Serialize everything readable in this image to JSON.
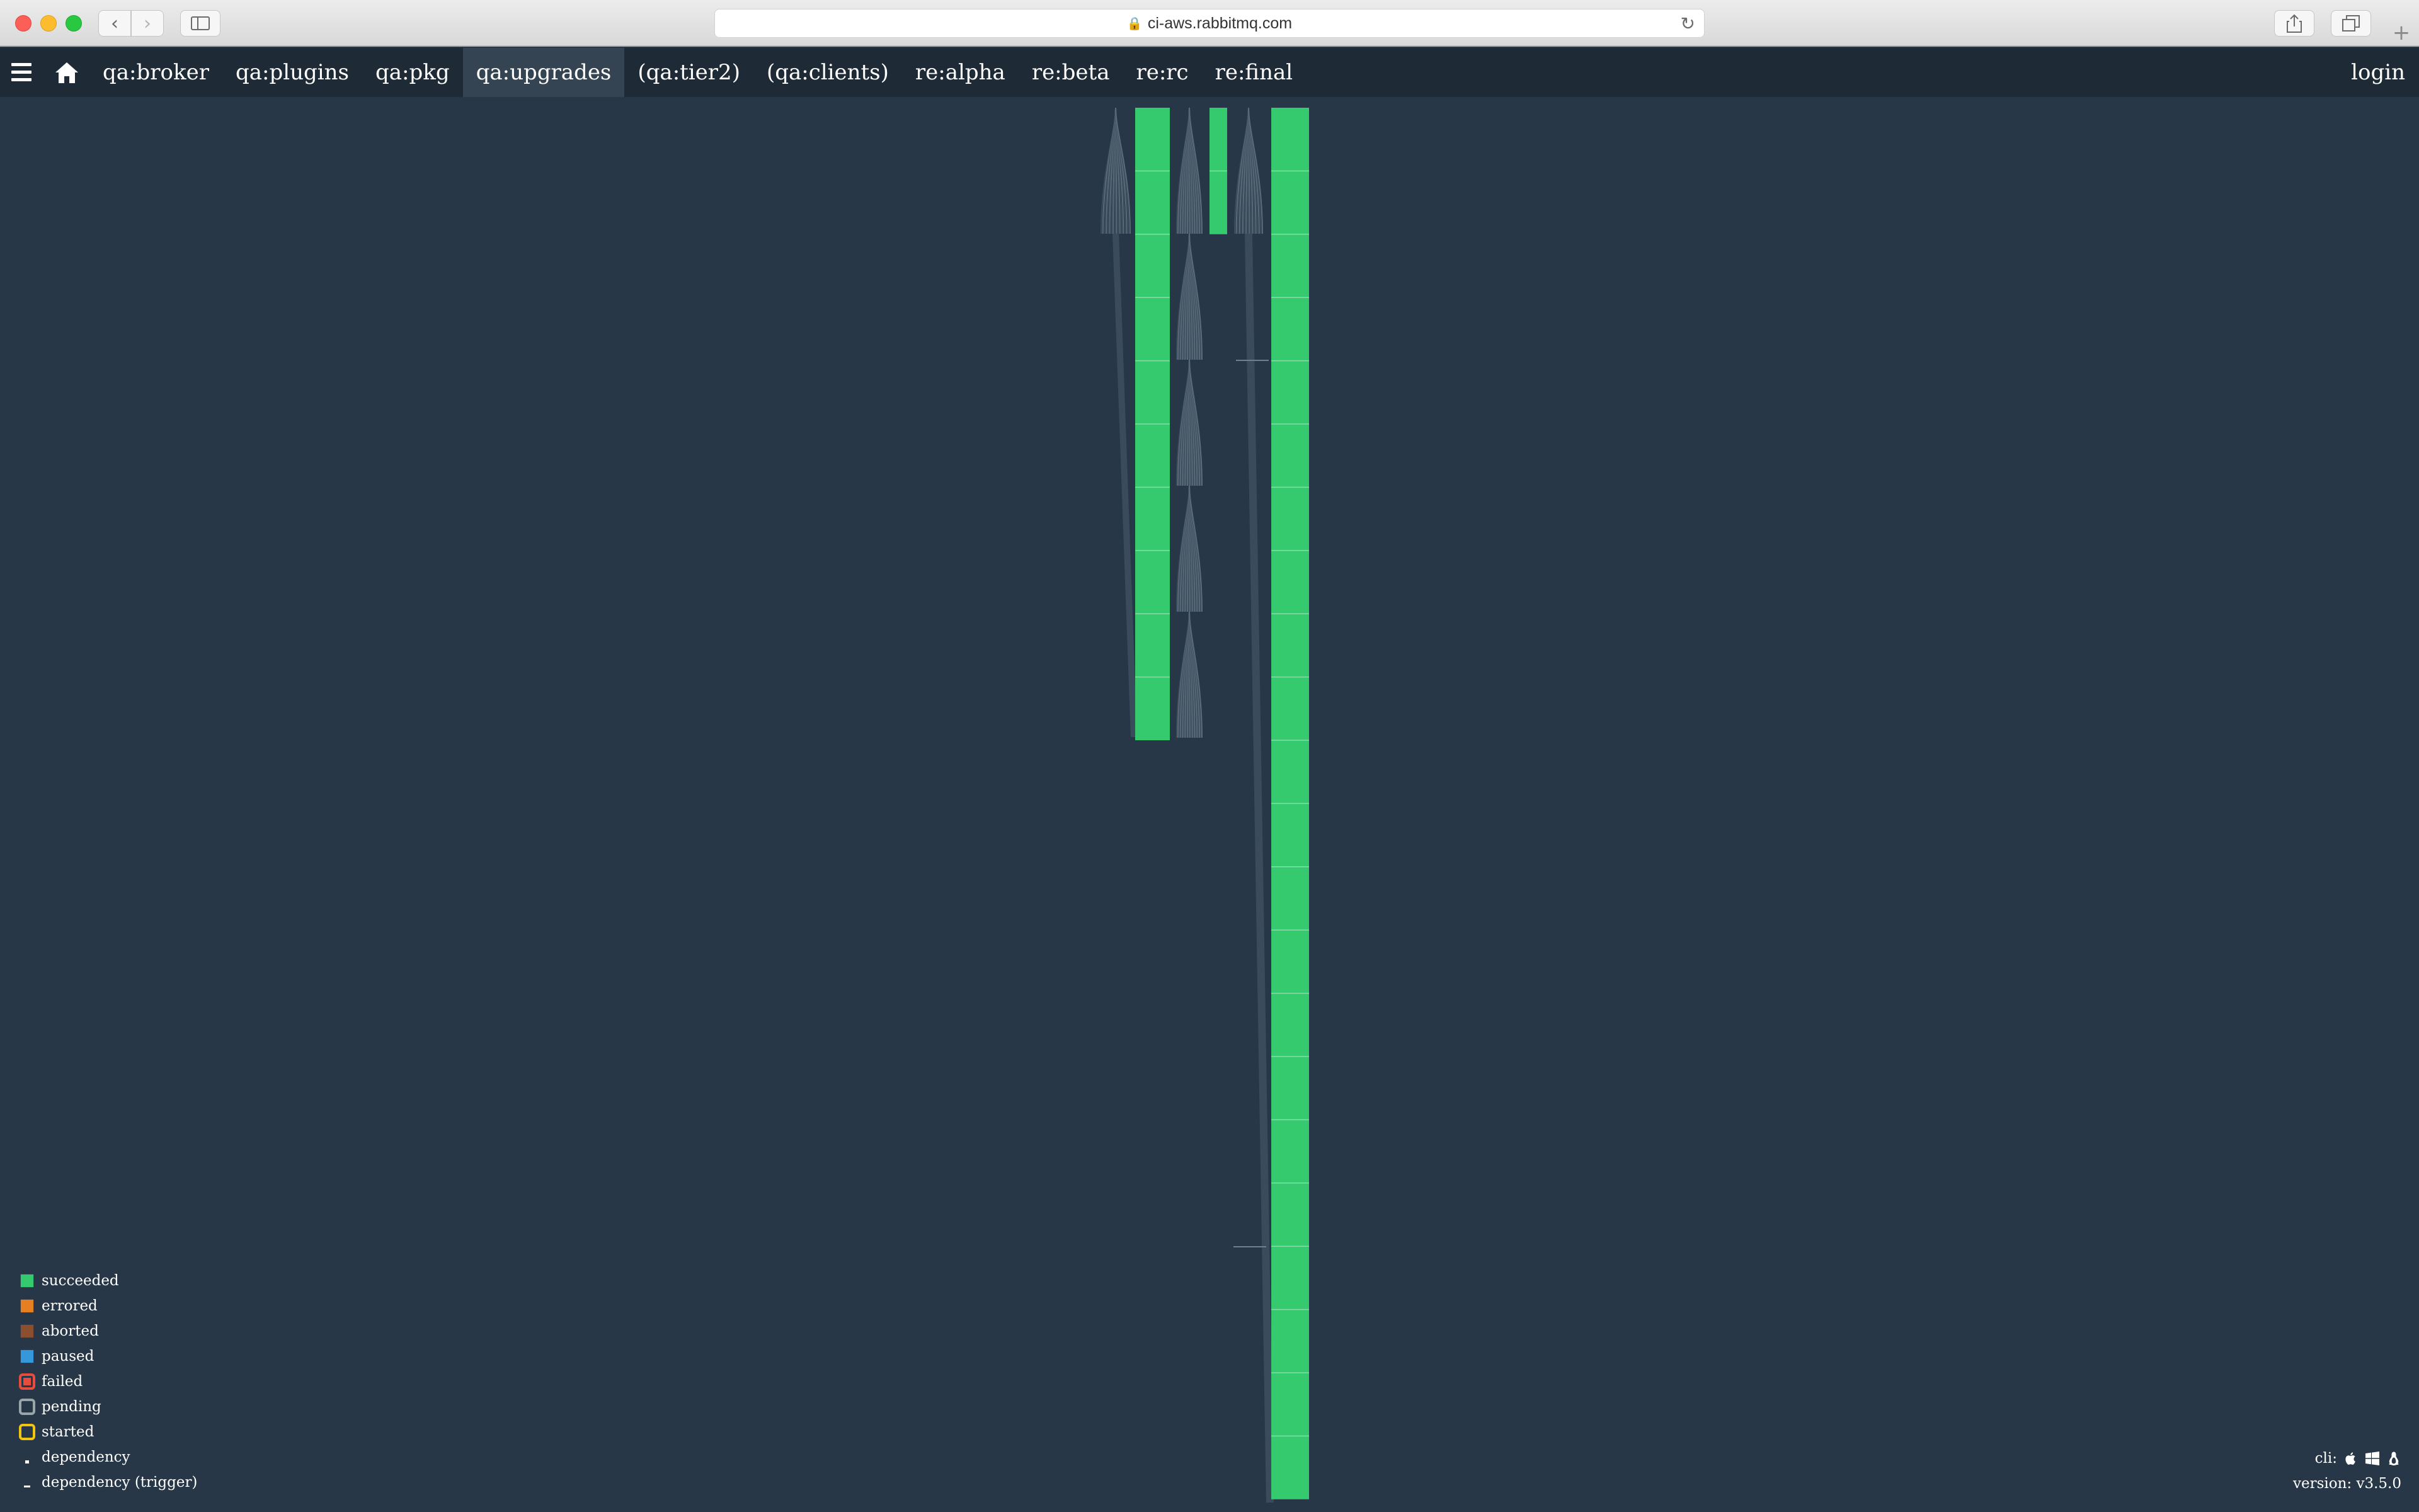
{
  "browser": {
    "url": "ci-aws.rabbitmq.com"
  },
  "topbar": {
    "groups": [
      {
        "label": "qa:broker",
        "active": false
      },
      {
        "label": "qa:plugins",
        "active": false
      },
      {
        "label": "qa:pkg",
        "active": false
      },
      {
        "label": "qa:upgrades",
        "active": true
      },
      {
        "label": "(qa:tier2)",
        "active": false
      },
      {
        "label": "(qa:clients)",
        "active": false
      },
      {
        "label": "re:alpha",
        "active": false
      },
      {
        "label": "re:beta",
        "active": false
      },
      {
        "label": "re:rc",
        "active": false
      },
      {
        "label": "re:final",
        "active": false
      }
    ],
    "login_label": "login"
  },
  "pipeline": {
    "colors": {
      "succeeded": "#36ca6f",
      "errored": "#e67e22",
      "aborted": "#8b4e2e",
      "paused": "#3498db",
      "failed": "#e74c3c",
      "pending": "#9aa4ab",
      "started": "#f1c40f",
      "edge": "#3a4c5b",
      "background": "#273747"
    },
    "columns": [
      {
        "id": "col-1",
        "job_count": 10,
        "status": "succeeded"
      },
      {
        "id": "col-2",
        "job_count": 2,
        "status": "succeeded"
      },
      {
        "id": "col-3",
        "job_count": 22,
        "status": "succeeded"
      }
    ]
  },
  "legend": [
    {
      "key": "succeeded",
      "label": "succeeded",
      "style": "fill"
    },
    {
      "key": "errored",
      "label": "errored",
      "style": "fill"
    },
    {
      "key": "aborted",
      "label": "aborted",
      "style": "fill"
    },
    {
      "key": "paused",
      "label": "paused",
      "style": "fill"
    },
    {
      "key": "failed",
      "label": "failed",
      "style": "ring"
    },
    {
      "key": "pending",
      "label": "pending",
      "style": "ring"
    },
    {
      "key": "started",
      "label": "started",
      "style": "ring"
    },
    {
      "key": "dependency",
      "label": "dependency",
      "style": "dep"
    },
    {
      "key": "dependency-trigger",
      "label": "dependency (trigger)",
      "style": "dep-trigger"
    }
  ],
  "footer": {
    "cli_label": "cli:",
    "cli_icons": [
      "apple-icon",
      "windows-icon",
      "linux-icon"
    ],
    "version_label": "version:",
    "version": "v3.5.0"
  }
}
